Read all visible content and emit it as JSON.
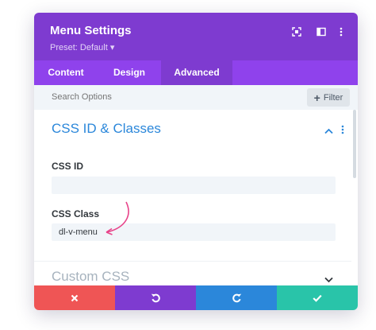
{
  "header": {
    "title": "Menu Settings",
    "preset": "Preset: Default ▾",
    "icons": [
      "focus-icon",
      "sidebar-toggle-icon",
      "more-options-icon"
    ]
  },
  "tabs": [
    {
      "label": "Content",
      "active": false
    },
    {
      "label": "Design",
      "active": false
    },
    {
      "label": "Advanced",
      "active": true
    }
  ],
  "search": {
    "placeholder": "Search Options",
    "filter_label": "Filter",
    "filter_icon": "+"
  },
  "sections": {
    "css_id_classes": {
      "title": "CSS ID & Classes",
      "expanded": true,
      "fields": {
        "css_id": {
          "label": "CSS ID",
          "value": ""
        },
        "css_class": {
          "label": "CSS Class",
          "value": "dl-v-menu"
        }
      }
    },
    "custom_css": {
      "title": "Custom CSS",
      "expanded": false
    }
  },
  "footer": {
    "buttons": [
      {
        "name": "close",
        "icon": "close-icon",
        "color": "#ef5555"
      },
      {
        "name": "undo",
        "icon": "undo-icon",
        "color": "#7e3bd0"
      },
      {
        "name": "redo",
        "icon": "redo-icon",
        "color": "#2b87da"
      },
      {
        "name": "save",
        "icon": "check-icon",
        "color": "#29c4a9"
      }
    ]
  },
  "colors": {
    "header_bg": "#7e3bd0",
    "tabs_bg": "#8f42ec",
    "accent_blue": "#2b87da",
    "arrow_pink": "#e8448a"
  }
}
